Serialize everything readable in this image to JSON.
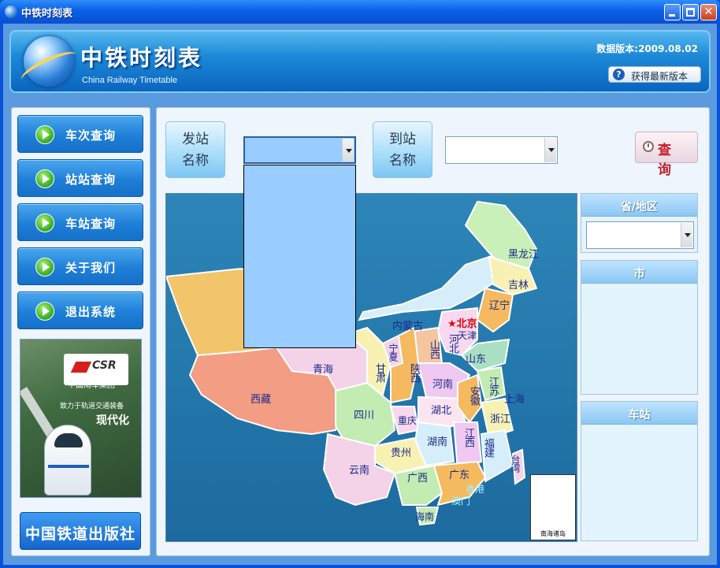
{
  "window": {
    "title": "中铁时刻表",
    "controls": [
      "minimize",
      "maximize",
      "close"
    ]
  },
  "header": {
    "title": "中铁时刻表",
    "subtitle": "China Railway Timetable",
    "version": "数据版本:2009.08.02",
    "update_button": "获得最新版本"
  },
  "nav": {
    "items": [
      {
        "label": "车次查询"
      },
      {
        "label": "站站查询"
      },
      {
        "label": "车站查询"
      },
      {
        "label": "关于我们"
      },
      {
        "label": "退出系统"
      }
    ]
  },
  "ad": {
    "brand": "CSR",
    "group": "中国南车集团",
    "slogan": "致力于轨道交通装备",
    "big_text": "现代化"
  },
  "publisher": {
    "label": "中国铁道出版社"
  },
  "search": {
    "from_label_1": "发站",
    "from_label_2": "名称",
    "to_label_1": "到站",
    "to_label_2": "名称",
    "from_value": "",
    "to_value": "",
    "query_button": "查 询"
  },
  "map": {
    "provinces": {
      "heilongjiang": "黑龙江",
      "jilin": "吉林",
      "liaoning": "辽宁",
      "neimenggu": "内蒙古",
      "beijing": "★北京",
      "tianjin": "天津",
      "hebei": "河北",
      "shanxi": "山西",
      "shandong": "山东",
      "ningxia": "宁夏",
      "gansu": "甘肃",
      "shaanxi": "陕西",
      "henan": "河南",
      "qinghai": "青海",
      "xizang": "西藏",
      "sichuan": "四川",
      "chongqing": "重庆",
      "hubei": "湖北",
      "anhui": "安徽",
      "jiangsu": "江苏",
      "shanghai": "上海",
      "zhejiang": "浙江",
      "hunan": "湖南",
      "jiangxi": "江西",
      "fujian": "福建",
      "guizhou": "贵州",
      "yunnan": "云南",
      "guangxi": "广西",
      "guangdong": "广东",
      "xianggang": "香港",
      "aomen": "澳门",
      "hainan": "海南",
      "taiwan": "台湾"
    },
    "inset_caption": "南海诸岛"
  },
  "filters": {
    "province_header": "省/地区",
    "province_value": "",
    "city_header": "市",
    "station_header": "车站"
  }
}
